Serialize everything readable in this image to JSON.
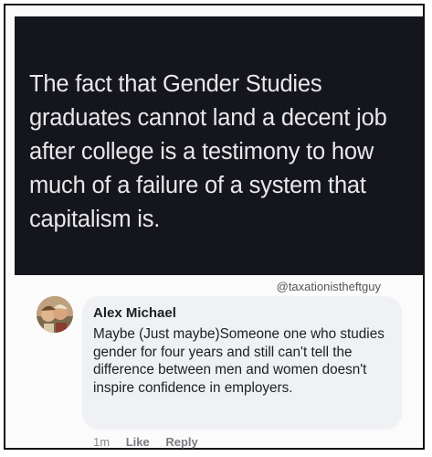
{
  "post": {
    "text": "The fact that Gender Studies graduates cannot land a decent job after college is a testimony to how much of a failure of a system that capitalism is.",
    "handle": "@taxationistheftguy"
  },
  "comment": {
    "author": "Alex Michael",
    "text": "Maybe (Just maybe)Someone one who studies gender for four years and still can't tell the difference between men and women doesn't inspire confidence in employers.",
    "time": "1m",
    "like_label": "Like",
    "reply_label": "Reply"
  },
  "colors": {
    "post_background": "#15161c",
    "post_text": "#e8e8ec",
    "bubble": "#eff1f4"
  }
}
